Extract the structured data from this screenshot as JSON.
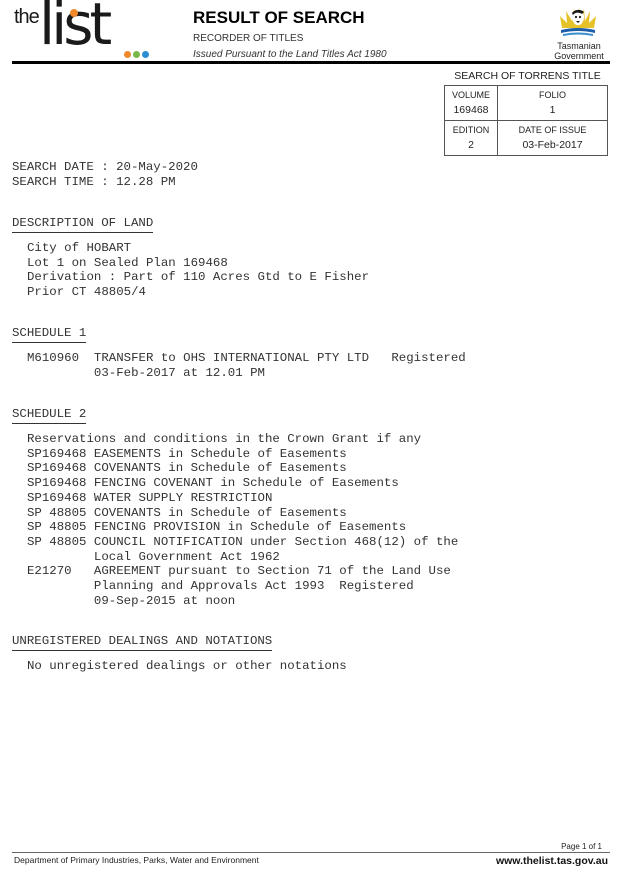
{
  "header": {
    "logo": {
      "prefix": "the",
      "word": "list",
      "dot_colors": [
        "#f0892a",
        "#7ab648",
        "#2a8fd0"
      ]
    },
    "title": "RESULT OF SEARCH",
    "subtitle": "RECORDER OF TITLES",
    "act": "Issued Pursuant to the Land Titles Act 1980",
    "gov_logo": {
      "line1": "Tasmanian",
      "line2": "Government"
    }
  },
  "torrens": {
    "caption": "SEARCH OF TORRENS TITLE",
    "volume_label": "VOLUME",
    "volume": "169468",
    "folio_label": "FOLIO",
    "folio": "1",
    "edition_label": "EDITION",
    "edition": "2",
    "date_label": "DATE OF ISSUE",
    "date": "03-Feb-2017"
  },
  "search": {
    "date_line": "SEARCH DATE : 20-May-2020",
    "time_line": "SEARCH TIME : 12.28 PM"
  },
  "description": {
    "heading": "DESCRIPTION OF LAND",
    "lines": [
      "City of HOBART",
      "Lot 1 on Sealed Plan 169468",
      "Derivation : Part of 110 Acres Gtd to E Fisher",
      "Prior CT 48805/4"
    ]
  },
  "schedule1": {
    "heading": "SCHEDULE 1",
    "lines": [
      "M610960  TRANSFER to OHS INTERNATIONAL PTY LTD   Registered",
      "         03-Feb-2017 at 12.01 PM"
    ]
  },
  "schedule2": {
    "heading": "SCHEDULE 2",
    "lines": [
      "Reservations and conditions in the Crown Grant if any",
      "SP169468 EASEMENTS in Schedule of Easements",
      "SP169468 COVENANTS in Schedule of Easements",
      "SP169468 FENCING COVENANT in Schedule of Easements",
      "SP169468 WATER SUPPLY RESTRICTION",
      "SP 48805 COVENANTS in Schedule of Easements",
      "SP 48805 FENCING PROVISION in Schedule of Easements",
      "SP 48805 COUNCIL NOTIFICATION under Section 468(12) of the",
      "         Local Government Act 1962",
      "E21270   AGREEMENT pursuant to Section 71 of the Land Use",
      "         Planning and Approvals Act 1993  Registered",
      "         09-Sep-2015 at noon"
    ]
  },
  "unregistered": {
    "heading": "UNREGISTERED DEALINGS AND NOTATIONS",
    "lines": [
      "No unregistered dealings or other notations"
    ]
  },
  "footer": {
    "page": "Page 1 of 1",
    "department": "Department of Primary Industries, Parks, Water and Environment",
    "website": "www.thelist.tas.gov.au"
  }
}
